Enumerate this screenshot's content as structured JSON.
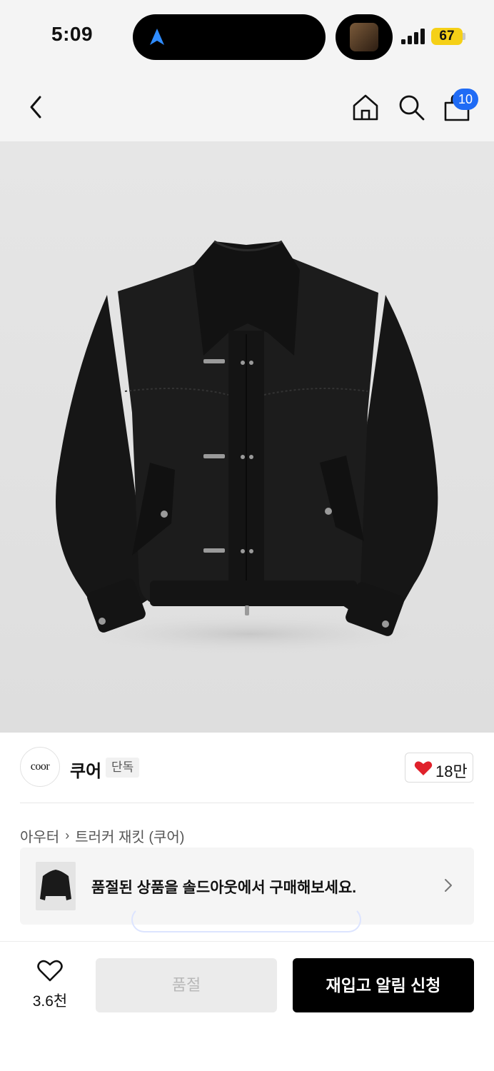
{
  "status_bar": {
    "time": "5:09",
    "battery": "67"
  },
  "header": {
    "cart_count": "10",
    "icons": [
      "back-icon",
      "home-icon",
      "search-icon",
      "shopping-bag-icon"
    ]
  },
  "product": {
    "brand_logo_text": "coor",
    "brand_name": "쿠어",
    "brand_tag": "단독",
    "likes": "18만",
    "category": "아우터",
    "breadcrumb_separator": "›",
    "product_name": "트러커 재킷 (쿠어)"
  },
  "soldout_banner": {
    "text": "품절된 상품을 솔드아웃에서 구매해보세요."
  },
  "bottom_bar": {
    "wish_count": "3.6천",
    "soldout_label": "품절",
    "restock_label": "재입고 알림 신청"
  },
  "colors": {
    "accent_blue": "#1f6bf5",
    "heart_red": "#e0212b",
    "battery_yellow": "#f5d017"
  }
}
